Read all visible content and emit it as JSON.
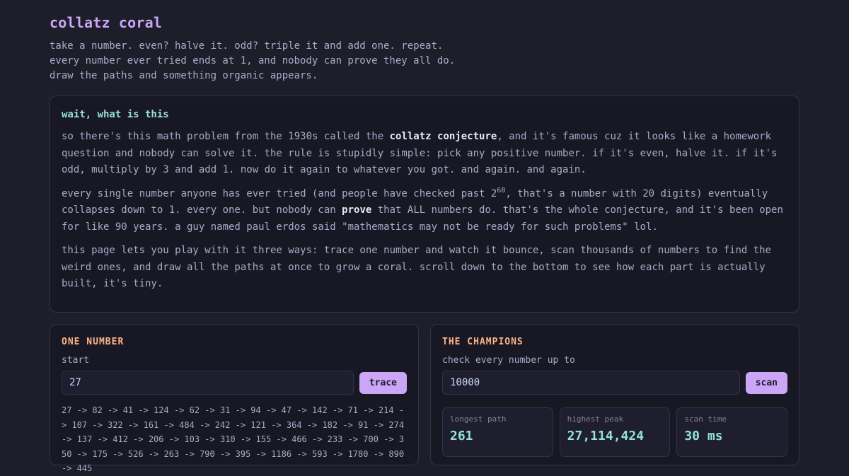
{
  "header": {
    "title": "collatz coral",
    "intro": [
      "take a number. even? halve it. odd? triple it and add one. repeat.",
      "every number ever tried ends at 1, and nobody can prove they all do.",
      "draw the paths and something organic appears."
    ]
  },
  "explainer": {
    "heading": "wait, what is this",
    "p1_a": "so there's this math problem from the 1930s called the ",
    "p1_strong": "collatz conjecture",
    "p1_b": ", and it's famous cuz it looks like a homework question and nobody can solve it. the rule is stupidly simple: pick any positive number. if it's even, halve it. if it's odd, multiply by 3 and add 1. now do it again to whatever you got. and again. and again.",
    "p2_a": "every single number anyone has ever tried (and people have checked past 2",
    "p2_sup": "68",
    "p2_b": ", that's a number with 20 digits) eventually collapses down to 1. every one. but nobody can ",
    "p2_strong": "prove",
    "p2_c": " that ALL numbers do. that's the whole conjecture, and it's been open for like 90 years. a guy named paul erdos said \"mathematics may not be ready for such problems\" lol.",
    "p3": "this page lets you play with it three ways: trace one number and watch it bounce, scan thousands of numbers to find the weird ones, and draw all the paths at once to grow a coral. scroll down to the bottom to see how each part is actually built, it's tiny."
  },
  "one_number": {
    "title": "ONE NUMBER",
    "start_label": "start",
    "start_value": "27",
    "trace_label": "trace",
    "trace_output": "27 -> 82 -> 41 -> 124 -> 62 -> 31 -> 94 -> 47 -> 142 -> 71 -> 214 -> 107 -> 322 -> 161 -> 484 -> 242 -> 121 -> 364 -> 182 -> 91 -> 274 -> 137 -> 412 -> 206 -> 103 -> 310 -> 155 -> 466 -> 233 -> 700 -> 350 -> 175 -> 526 -> 263 -> 790 -> 395 -> 1186 -> 593 -> 1780 -> 890 -> 445"
  },
  "champions": {
    "title": "THE CHAMPIONS",
    "check_label": "check every number up to",
    "limit_value": "10000",
    "scan_label": "scan",
    "stats": [
      {
        "label": "longest path",
        "value": "261"
      },
      {
        "label": "highest peak",
        "value": "27,114,424"
      },
      {
        "label": "scan time",
        "value": "30 ms"
      }
    ]
  }
}
